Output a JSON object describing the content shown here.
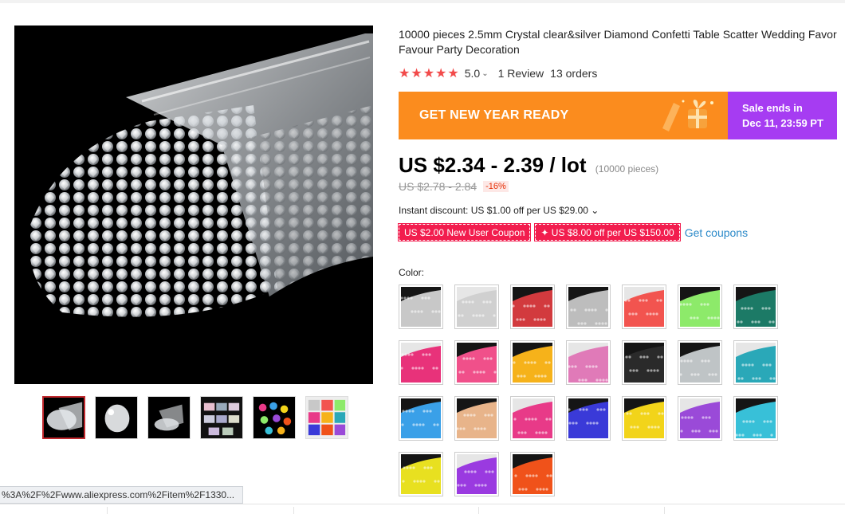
{
  "product": {
    "title": "10000 pieces 2.5mm Crystal clear&silver Diamond Confetti Table Scatter Wedding Favor Favour Party Decoration",
    "rating": {
      "stars": "★★★★★",
      "score": "5.0",
      "chevron": "⌄",
      "reviews": "1 Review",
      "orders": "13 orders"
    }
  },
  "banner": {
    "left_text": "GET NEW YEAR READY",
    "sale_line1": "Sale ends in",
    "sale_line2": "Dec 11, 23:59 PT",
    "left_color": "#fb8c1e",
    "right_color": "#a63cf2"
  },
  "pricing": {
    "price": "US $2.34 - 2.39 / lot",
    "unit_note": "(10000 pieces)",
    "old_price": "US $2.78 - 2.84",
    "discount": "-16%",
    "instant_discount": "Instant discount: US $1.00 off per US $29.00 ⌄",
    "coupons": [
      "US $2.00 New User Coupon",
      "✦ US $8.00 off per US $150.00"
    ],
    "get_coupons": "Get coupons"
  },
  "color_label": "Color:",
  "swatch_colors": [
    "#c8c8c8",
    "#d0d0d0",
    "#d23a3e",
    "#bdbdbd",
    "#f2544f",
    "#8dea6a",
    "#1c7a66",
    "#e8327a",
    "#f0508a",
    "#f6b21a",
    "#e07ab8",
    "#2a2a2a",
    "#bfc4c6",
    "#2aa8b8",
    "#3aa0e8",
    "#e8b48a",
    "#e83a88",
    "#3a3ad8",
    "#f2d41a",
    "#9a4ad8",
    "#38c0d8",
    "#e8e020",
    "#9a3ae0",
    "#f0521a"
  ],
  "status_url": "%3A%2F%2Fwww.aliexpress.com%2Fitem%2F1330..."
}
